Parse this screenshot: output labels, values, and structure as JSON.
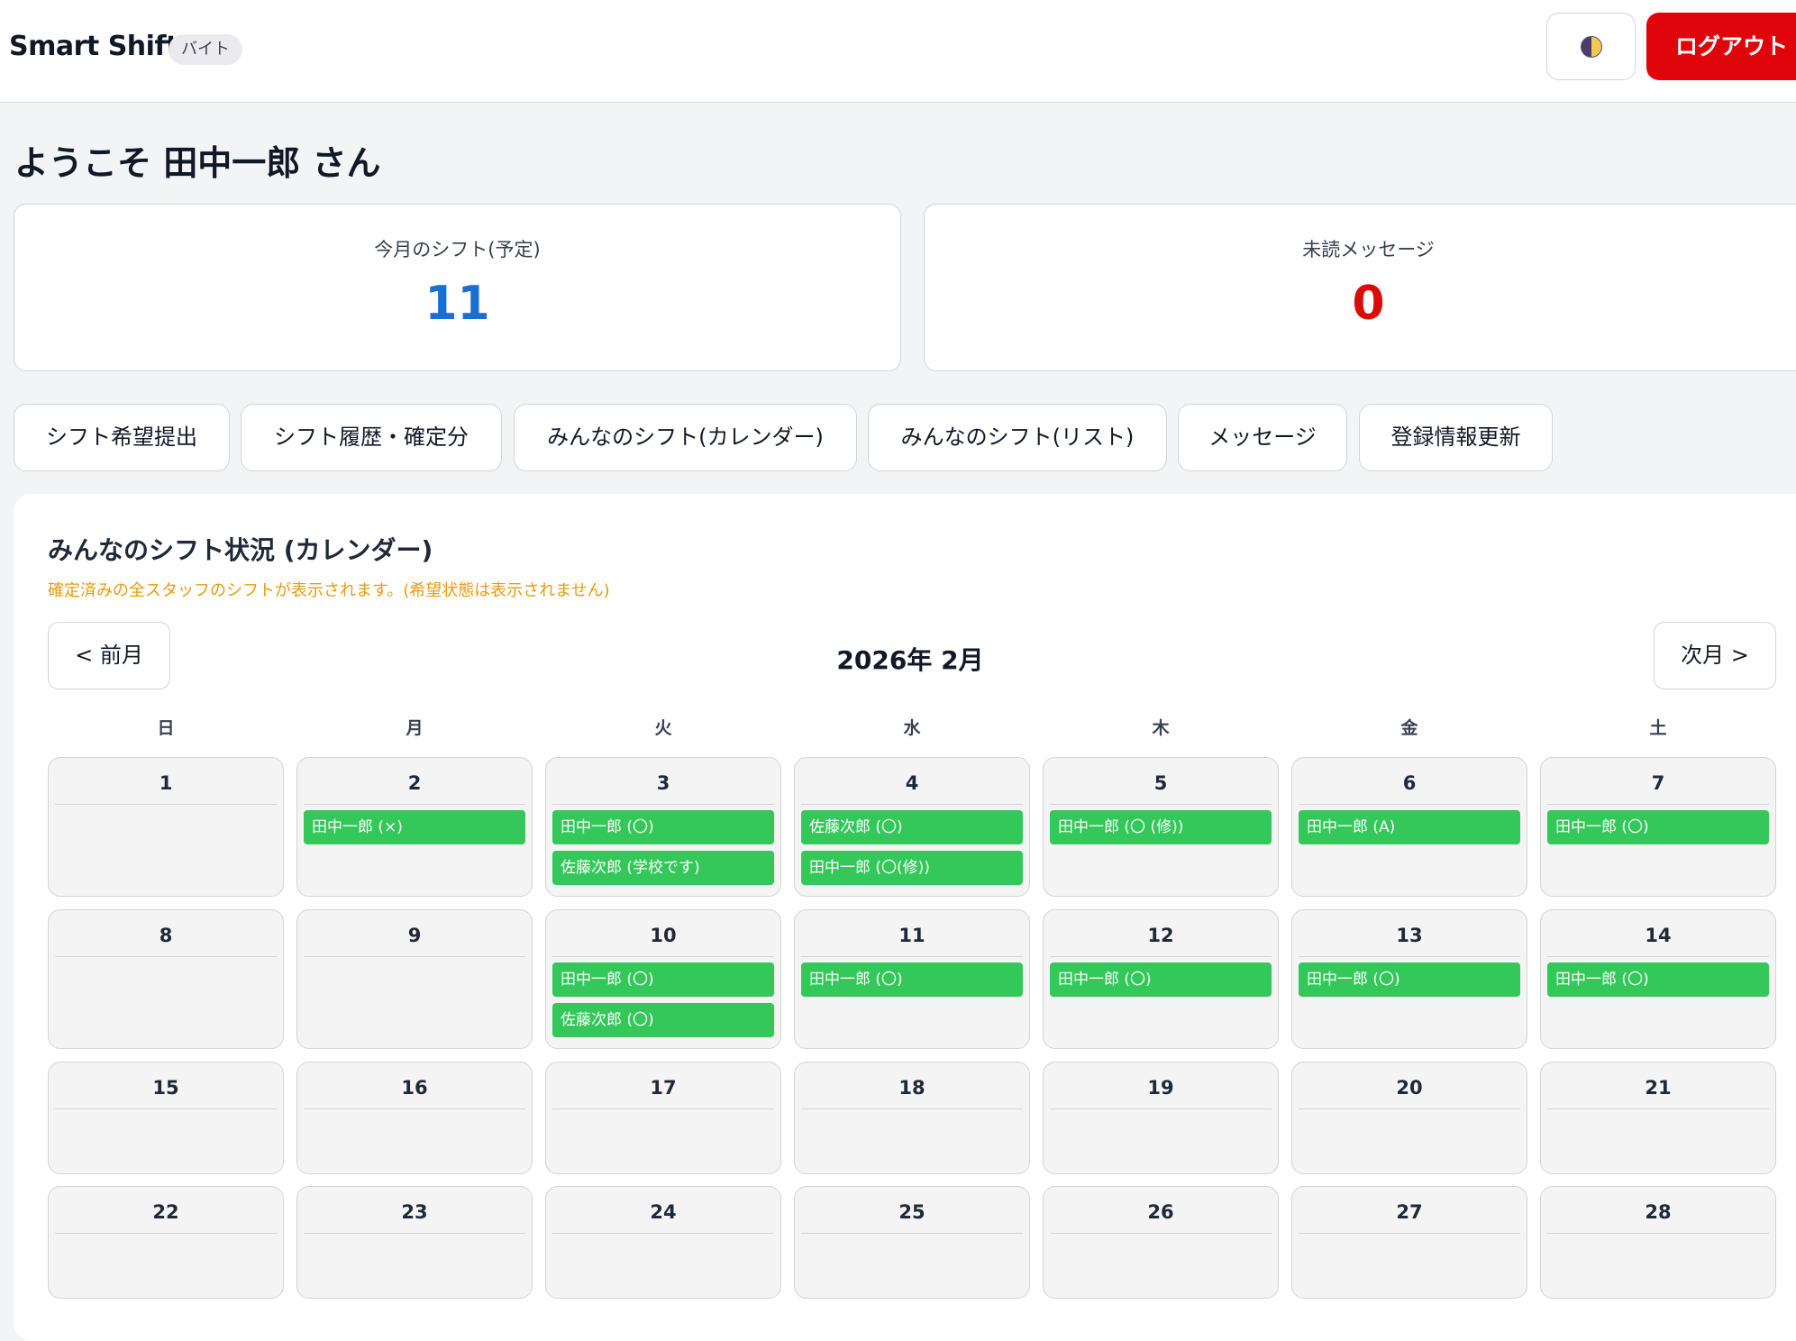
{
  "header": {
    "brand": "Smart Shift",
    "role_badge": "バイト",
    "theme_icon": "half-moon-icon",
    "logout_label": "ログアウト",
    "logout_color": "#e0040b"
  },
  "welcome": "ようこそ 田中一郎 さん",
  "stats": [
    {
      "label": "今月のシフト(予定)",
      "value": "11",
      "color": "#1a6fd4"
    },
    {
      "label": "未読メッセージ",
      "value": "0",
      "color": "#d90b0b"
    }
  ],
  "nav": [
    "シフト希望提出",
    "シフト履歴・確定分",
    "みんなのシフト(カレンダー)",
    "みんなのシフト(リスト)",
    "メッセージ",
    "登録情報更新"
  ],
  "calendar": {
    "title": "みんなのシフト状況 (カレンダー)",
    "note": "確定済みの全スタッフのシフトが表示されます。(希望状態は表示されません)",
    "prev_label": "< 前月",
    "next_label": "次月 >",
    "month_label": "2026年 2月",
    "weekdays": [
      "日",
      "月",
      "火",
      "水",
      "木",
      "金",
      "土"
    ],
    "shift_color": "#34c759",
    "weeks": [
      [
        {
          "day": "1",
          "shifts": []
        },
        {
          "day": "2",
          "shifts": [
            "田中一郎 (×)"
          ]
        },
        {
          "day": "3",
          "shifts": [
            "田中一郎 (〇)",
            "佐藤次郎 (学校です)"
          ]
        },
        {
          "day": "4",
          "shifts": [
            "佐藤次郎 (〇)",
            "田中一郎 (〇(修))"
          ]
        },
        {
          "day": "5",
          "shifts": [
            "田中一郎 (〇 (修))"
          ]
        },
        {
          "day": "6",
          "shifts": [
            "田中一郎 (A)"
          ]
        },
        {
          "day": "7",
          "shifts": [
            "田中一郎 (〇)"
          ]
        }
      ],
      [
        {
          "day": "8",
          "shifts": []
        },
        {
          "day": "9",
          "shifts": []
        },
        {
          "day": "10",
          "shifts": [
            "田中一郎 (〇)",
            "佐藤次郎 (〇)"
          ]
        },
        {
          "day": "11",
          "shifts": [
            "田中一郎 (〇)"
          ]
        },
        {
          "day": "12",
          "shifts": [
            "田中一郎 (〇)"
          ]
        },
        {
          "day": "13",
          "shifts": [
            "田中一郎 (〇)"
          ]
        },
        {
          "day": "14",
          "shifts": [
            "田中一郎 (〇)"
          ]
        }
      ],
      [
        {
          "day": "15",
          "shifts": []
        },
        {
          "day": "16",
          "shifts": []
        },
        {
          "day": "17",
          "shifts": []
        },
        {
          "day": "18",
          "shifts": []
        },
        {
          "day": "19",
          "shifts": []
        },
        {
          "day": "20",
          "shifts": []
        },
        {
          "day": "21",
          "shifts": []
        }
      ],
      [
        {
          "day": "22",
          "shifts": []
        },
        {
          "day": "23",
          "shifts": []
        },
        {
          "day": "24",
          "shifts": []
        },
        {
          "day": "25",
          "shifts": []
        },
        {
          "day": "26",
          "shifts": []
        },
        {
          "day": "27",
          "shifts": []
        },
        {
          "day": "28",
          "shifts": []
        }
      ]
    ]
  }
}
